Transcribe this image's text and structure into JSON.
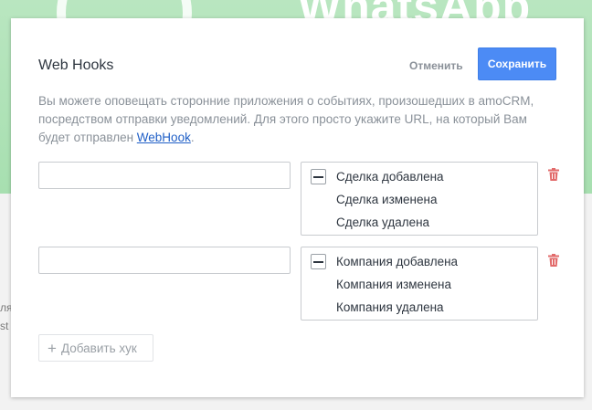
{
  "background": {
    "title": "WhatsApp",
    "side_text": [
      "ля",
      "st"
    ]
  },
  "modal": {
    "title": "Web Hooks",
    "cancel_label": "Отменить",
    "save_label": "Сохранить",
    "description_text": "Вы можете оповещать сторонние приложения о событиях, произошедших в amoCRM, посредством отправки уведомлений. Для этого просто укажите URL, на который Вам будет отправлен ",
    "description_link": "WebHook",
    "description_end": ".",
    "hooks": [
      {
        "url": "",
        "events": [
          "Сделка добавлена",
          "Сделка изменена",
          "Сделка удалена"
        ]
      },
      {
        "url": "",
        "events": [
          "Компания добавлена",
          "Компания изменена",
          "Компания удалена"
        ]
      }
    ],
    "add_hook_label": "Добавить хук"
  },
  "colors": {
    "accent": "#4c8bf5",
    "trash": "#e26b6b",
    "link": "#1f5fc7",
    "banner": "#a7dfb0"
  },
  "icons": [
    "collapse-toggle-icon",
    "trash-icon",
    "plus-icon"
  ]
}
